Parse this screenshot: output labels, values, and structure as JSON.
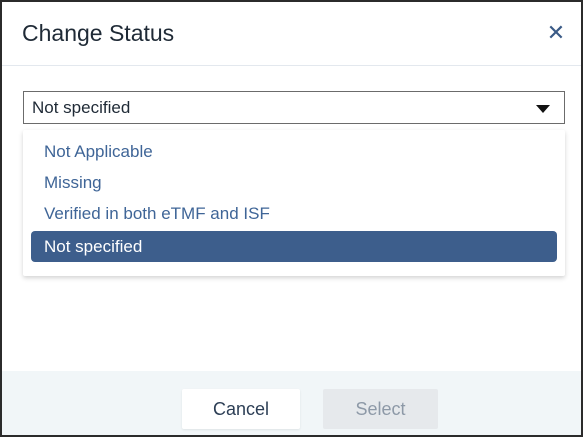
{
  "dialog": {
    "title": "Change Status",
    "close_icon": "close-icon"
  },
  "select": {
    "value": "Not specified"
  },
  "dropdown": {
    "options": [
      {
        "label": "Not Applicable",
        "selected": false
      },
      {
        "label": "Missing",
        "selected": false
      },
      {
        "label": "Verified in both eTMF and ISF",
        "selected": false
      },
      {
        "label": "Not specified",
        "selected": true
      }
    ]
  },
  "footer": {
    "cancel_label": "Cancel",
    "select_label": "Select",
    "select_enabled": false
  },
  "colors": {
    "accent": "#3d5e8c",
    "option_text": "#3f6597",
    "footer_bg": "#f1f6f8"
  }
}
